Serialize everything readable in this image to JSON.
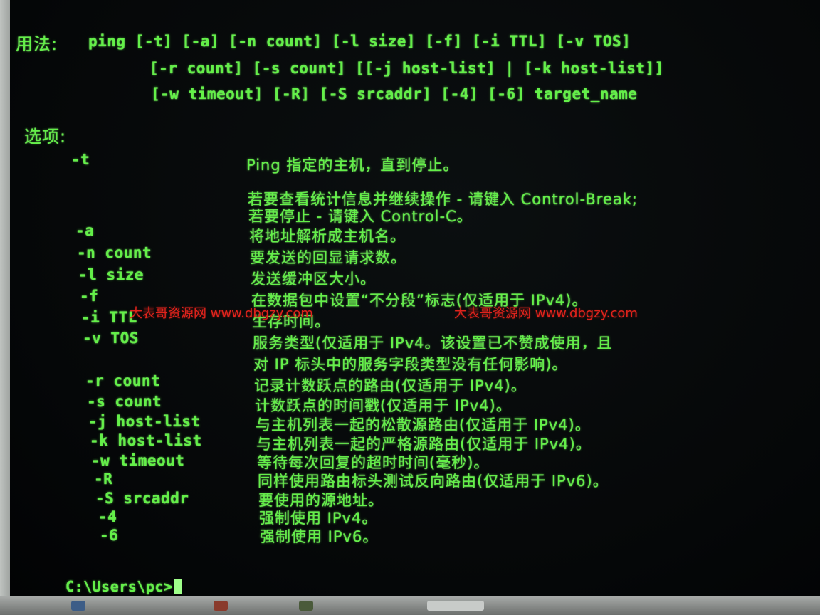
{
  "usage": {
    "label": "用法:",
    "lines": [
      "ping [-t] [-a] [-n count] [-l size] [-f] [-i TTL] [-v TOS]",
      "[-r count] [-s count] [[-j host-list] | [-k host-list]]",
      "[-w timeout] [-R] [-S srcaddr] [-4] [-6] target_name"
    ]
  },
  "options_label": "选项:",
  "options": [
    {
      "flag": "-t",
      "desc": [
        "Ping 指定的主机，直到停止。",
        "若要查看统计信息并继续操作 - 请键入 Control-Break;",
        "若要停止 - 请键入 Control-C。"
      ]
    },
    {
      "flag": "-a",
      "desc": [
        "将地址解析成主机名。"
      ]
    },
    {
      "flag": "-n count",
      "desc": [
        "要发送的回显请求数。"
      ]
    },
    {
      "flag": "-l size",
      "desc": [
        "发送缓冲区大小。"
      ]
    },
    {
      "flag": "-f",
      "desc": [
        "在数据包中设置“不分段”标志(仅适用于 IPv4)。"
      ]
    },
    {
      "flag": "-i TTL",
      "desc": [
        "生存时间。"
      ]
    },
    {
      "flag": "-v TOS",
      "desc": [
        "服务类型(仅适用于 IPv4。该设置已不赞成使用，且",
        "对 IP 标头中的服务字段类型没有任何影响)。"
      ]
    },
    {
      "flag": "-r count",
      "desc": [
        "记录计数跃点的路由(仅适用于 IPv4)。"
      ]
    },
    {
      "flag": "-s count",
      "desc": [
        "计数跃点的时间戳(仅适用于 IPv4)。"
      ]
    },
    {
      "flag": "-j host-list",
      "desc": [
        "与主机列表一起的松散源路由(仅适用于 IPv4)。"
      ]
    },
    {
      "flag": "-k host-list",
      "desc": [
        "与主机列表一起的严格源路由(仅适用于 IPv4)。"
      ]
    },
    {
      "flag": "-w timeout",
      "desc": [
        "等待每次回复的超时时间(毫秒)。"
      ]
    },
    {
      "flag": "-R",
      "desc": [
        "同样使用路由标头测试反向路由(仅适用于 IPv6)。"
      ]
    },
    {
      "flag": "-S srcaddr",
      "desc": [
        "要使用的源地址。"
      ]
    },
    {
      "flag": "-4",
      "desc": [
        "强制使用 IPv4。"
      ]
    },
    {
      "flag": "-6",
      "desc": [
        "强制使用 IPv6。"
      ]
    }
  ],
  "watermarks": [
    "大表哥资源网 www.dbgzy.com",
    "大表哥资源网 www.dbgzy.com"
  ],
  "prompt": "C:\\Users\\pc>",
  "colors": {
    "terminal_text": "#63f048",
    "watermark": "#e0231c",
    "background": "#050708"
  }
}
